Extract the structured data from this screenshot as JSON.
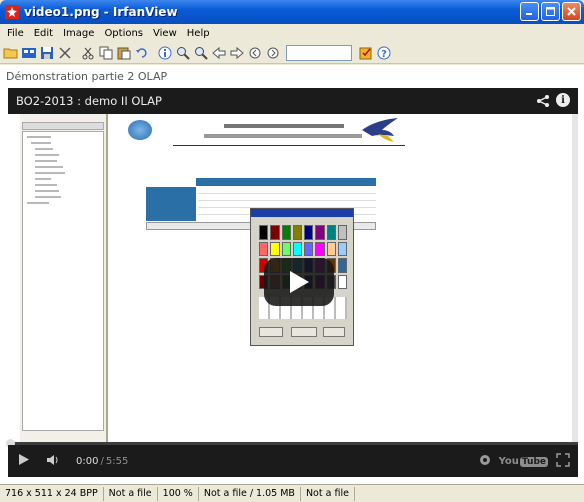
{
  "window": {
    "title": "video1.png - IrfanView",
    "buttons": [
      "minimize",
      "maximize",
      "close"
    ]
  },
  "menu": [
    "File",
    "Edit",
    "Image",
    "Options",
    "View",
    "Help"
  ],
  "toolbar": {
    "icons": [
      "open-folder-icon",
      "thumbnails-icon",
      "save-icon",
      "delete-icon",
      "cut-icon",
      "copy-icon",
      "paste-icon",
      "undo-icon",
      "info-icon",
      "zoom-in-icon",
      "zoom-out-icon",
      "previous-icon",
      "next-icon",
      "first-icon",
      "last-icon",
      "slideshow-icon",
      "help-icon"
    ],
    "search_value": ""
  },
  "video": {
    "page_title": "Démonstration partie 2 OLAP",
    "player_title": "BO2-2013 : demo II OLAP",
    "time_current": "0:00",
    "time_separator": "/",
    "time_total": "5:55",
    "progress": 0,
    "yt_text": "You",
    "yt_tube": "Tube"
  },
  "status": {
    "dimensions": "716 x 511 x 24 BPP",
    "file1": "Not a file",
    "zoom": "100 %",
    "file_size": "Not a file / 1.05 MB",
    "file2": "Not a file"
  },
  "colors": {
    "titlebar": "#0a5bd8",
    "player_bg": "#1b1b1b",
    "table_header": "#2a6fa6"
  }
}
